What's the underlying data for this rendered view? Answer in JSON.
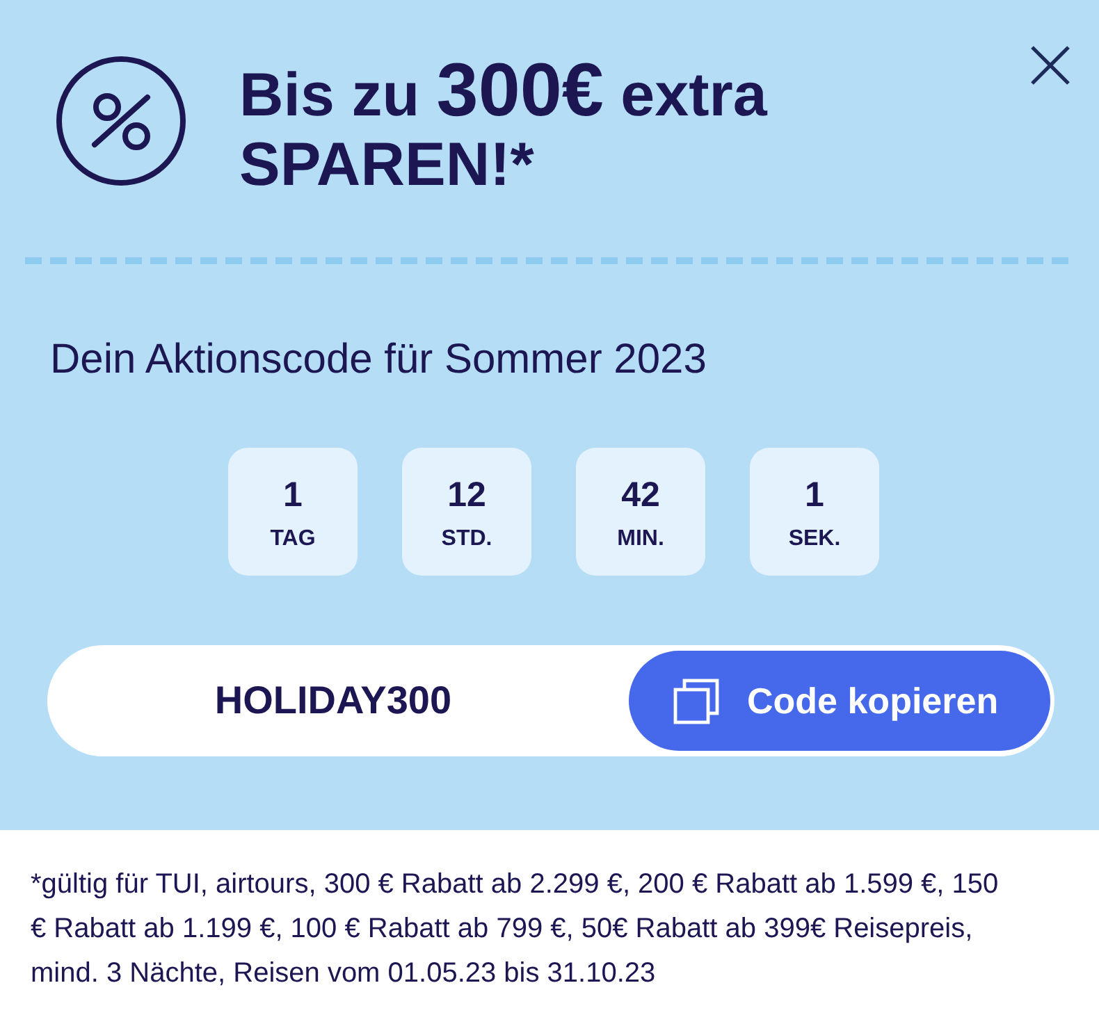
{
  "promo": {
    "headline": [
      {
        "text": "Bis zu ",
        "kind": "plain"
      },
      {
        "text": "300€",
        "kind": "amount"
      },
      {
        "text": " extra SPAREN!*",
        "kind": "plain"
      }
    ]
  },
  "code_section": {
    "title": "Dein Aktionscode für Sommer 2023",
    "countdown": [
      {
        "value": "1",
        "unit": "TAG"
      },
      {
        "value": "12",
        "unit": "STD."
      },
      {
        "value": "42",
        "unit": "MIN."
      },
      {
        "value": "1",
        "unit": "SEK."
      }
    ],
    "code": "HOLIDAY300",
    "copy_button": "Code kopieren"
  },
  "footnote": "*gültig für TUI, airtours, 300 € Rabatt ab 2.299 €, 200 € Rabatt ab 1.599 €, 150 € Rabatt ab 1.199 €, 100 € Rabatt ab 799 €, 50€ Rabatt ab 399€ Reisepreis, mind. 3 Nächte, Reisen vom 01.05.23 bis 31.10.23"
}
